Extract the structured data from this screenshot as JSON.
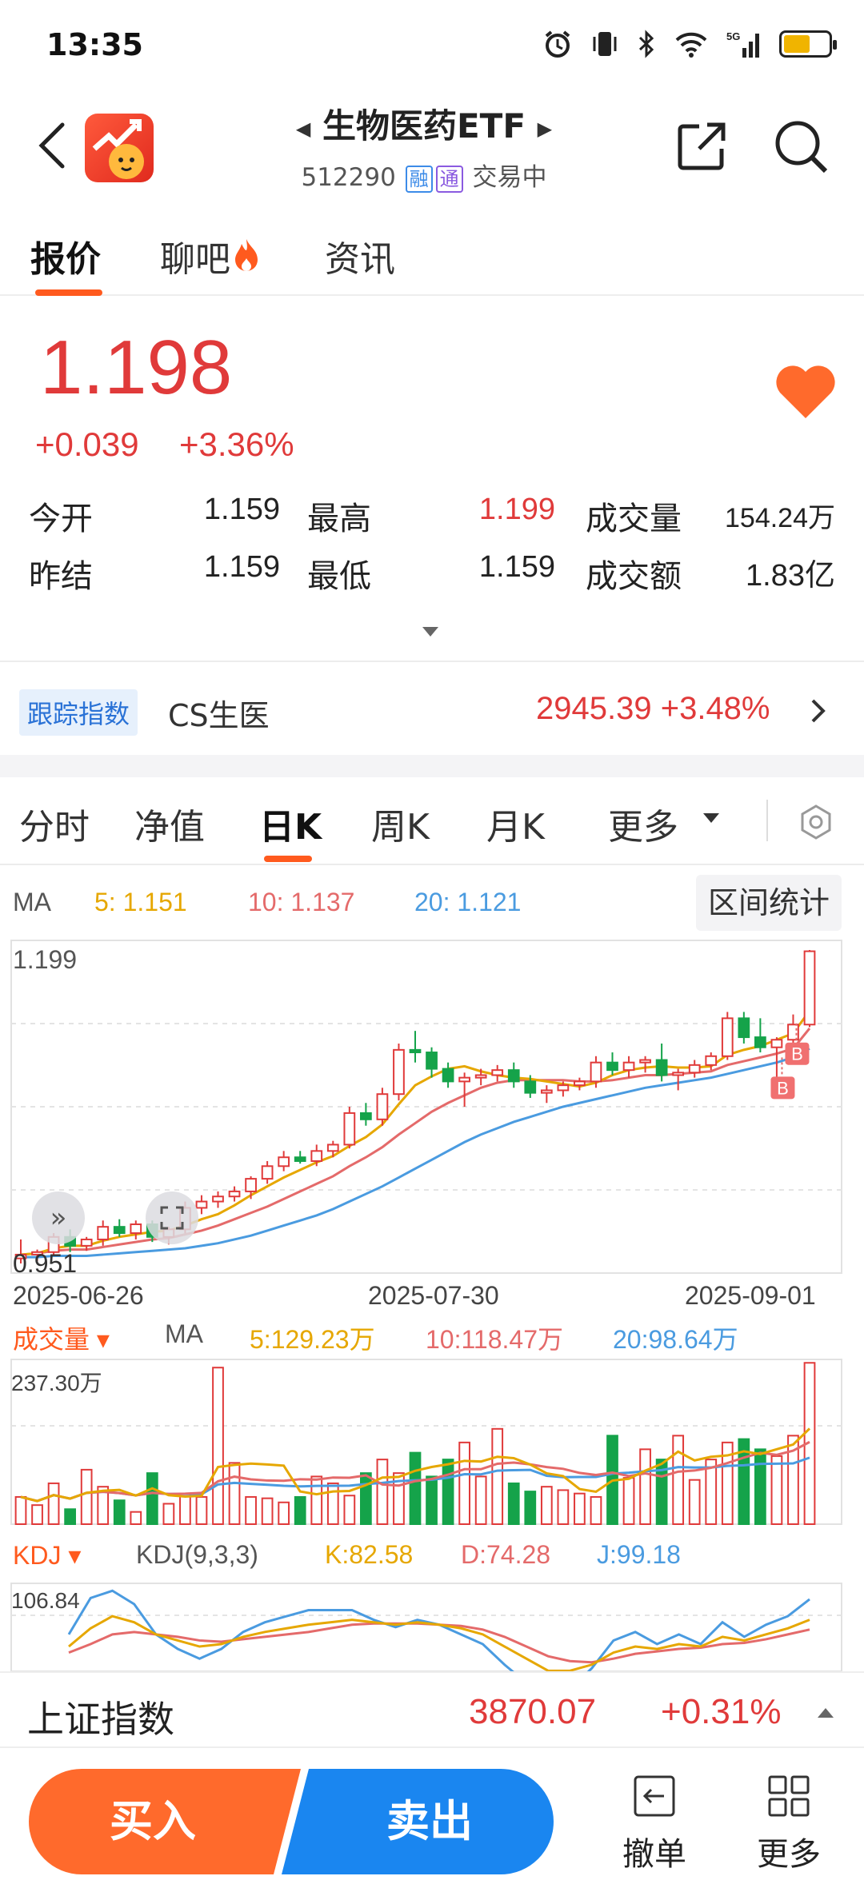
{
  "status": {
    "time": "13:35"
  },
  "header": {
    "title": "生物医药ETF",
    "code": "512290",
    "tag1": "融",
    "tag2": "通",
    "trade_status": "交易中"
  },
  "tabs": [
    {
      "label": "报价"
    },
    {
      "label": "聊吧"
    },
    {
      "label": "资讯"
    }
  ],
  "quote": {
    "price": "1.198",
    "change": "+0.039",
    "change_pct": "+3.36%",
    "open_label": "今开",
    "open": "1.159",
    "high_label": "最高",
    "high": "1.199",
    "vol_label": "成交量",
    "vol": "154.24万",
    "prev_label": "昨结",
    "prev": "1.159",
    "low_label": "最低",
    "low": "1.159",
    "amt_label": "成交额",
    "amt": "1.83亿"
  },
  "tracking": {
    "tag": "跟踪指数",
    "name": "CS生医",
    "value": "2945.39",
    "pct": "+3.48%"
  },
  "ktabs": [
    {
      "label": "分时"
    },
    {
      "label": "净值"
    },
    {
      "label": "日K"
    },
    {
      "label": "周K"
    },
    {
      "label": "月K"
    },
    {
      "label": "更多"
    }
  ],
  "ma": {
    "label": "MA",
    "ma5": "5: 1.151",
    "ma10": "10: 1.137",
    "ma20": "20: 1.121",
    "range_button": "区间统计"
  },
  "price_chart": {
    "max_label": "1.199",
    "min_label": "0.951",
    "dates": [
      "2025-06-26",
      "2025-07-30",
      "2025-09-01"
    ],
    "marker": "B"
  },
  "volume": {
    "label": "成交量",
    "ma_label": "MA",
    "ma5": "5:129.23万",
    "ma10": "10:118.47万",
    "ma20": "20:98.64万",
    "max_label": "237.30万"
  },
  "kdj": {
    "label": "KDJ",
    "params": "KDJ(9,3,3)",
    "k": "K:82.58",
    "d": "D:74.28",
    "j": "J:99.18",
    "max_label": "106.84"
  },
  "index_bar": {
    "name": "上证指数",
    "value": "3870.07",
    "pct": "+0.31%"
  },
  "actions": {
    "buy": "买入",
    "sell": "卖出",
    "cancel": "撤单",
    "more": "更多"
  },
  "colors": {
    "up": "#e03a3a",
    "down": "#15a34a",
    "accent": "#ff5a1e",
    "ma5": "#e6a700",
    "ma10": "#e46a6a",
    "ma20": "#4a9be0"
  },
  "chart_data": {
    "type": "candlestick",
    "ohlc": [
      [
        0.955,
        0.97,
        0.951,
        0.958
      ],
      [
        0.958,
        0.962,
        0.953,
        0.96
      ],
      [
        0.96,
        0.975,
        0.957,
        0.972
      ],
      [
        0.972,
        0.978,
        0.96,
        0.965
      ],
      [
        0.965,
        0.972,
        0.961,
        0.97
      ],
      [
        0.97,
        0.985,
        0.965,
        0.98
      ],
      [
        0.98,
        0.986,
        0.972,
        0.975
      ],
      [
        0.975,
        0.985,
        0.97,
        0.982
      ],
      [
        0.982,
        0.985,
        0.968,
        0.972
      ],
      [
        0.972,
        0.98,
        0.966,
        0.978
      ],
      [
        0.978,
        1.0,
        0.975,
        0.995
      ],
      [
        0.995,
        1.005,
        0.99,
        1.0
      ],
      [
        1.0,
        1.008,
        0.995,
        1.004
      ],
      [
        1.004,
        1.012,
        1.0,
        1.008
      ],
      [
        1.008,
        1.02,
        1.002,
        1.018
      ],
      [
        1.018,
        1.032,
        1.014,
        1.028
      ],
      [
        1.028,
        1.04,
        1.024,
        1.035
      ],
      [
        1.035,
        1.04,
        1.03,
        1.032
      ],
      [
        1.032,
        1.045,
        1.028,
        1.04
      ],
      [
        1.04,
        1.048,
        1.035,
        1.045
      ],
      [
        1.045,
        1.075,
        1.042,
        1.07
      ],
      [
        1.07,
        1.078,
        1.06,
        1.065
      ],
      [
        1.065,
        1.09,
        1.06,
        1.085
      ],
      [
        1.085,
        1.125,
        1.08,
        1.12
      ],
      [
        1.12,
        1.135,
        1.11,
        1.118
      ],
      [
        1.118,
        1.122,
        1.098,
        1.105
      ],
      [
        1.105,
        1.11,
        1.09,
        1.095
      ],
      [
        1.095,
        1.102,
        1.075,
        1.098
      ],
      [
        1.098,
        1.105,
        1.092,
        1.1
      ],
      [
        1.1,
        1.108,
        1.095,
        1.104
      ],
      [
        1.104,
        1.11,
        1.09,
        1.095
      ],
      [
        1.095,
        1.1,
        1.082,
        1.086
      ],
      [
        1.086,
        1.092,
        1.078,
        1.088
      ],
      [
        1.088,
        1.095,
        1.083,
        1.092
      ],
      [
        1.092,
        1.098,
        1.088,
        1.095
      ],
      [
        1.095,
        1.115,
        1.09,
        1.11
      ],
      [
        1.11,
        1.118,
        1.1,
        1.104
      ],
      [
        1.104,
        1.115,
        1.098,
        1.11
      ],
      [
        1.11,
        1.115,
        1.102,
        1.112
      ],
      [
        1.112,
        1.125,
        1.095,
        1.1
      ],
      [
        1.1,
        1.105,
        1.088,
        1.102
      ],
      [
        1.102,
        1.112,
        1.098,
        1.108
      ],
      [
        1.108,
        1.118,
        1.104,
        1.115
      ],
      [
        1.115,
        1.15,
        1.112,
        1.145
      ],
      [
        1.145,
        1.15,
        1.125,
        1.13
      ],
      [
        1.13,
        1.145,
        1.118,
        1.122
      ],
      [
        1.122,
        1.13,
        1.09,
        1.128
      ],
      [
        1.128,
        1.148,
        1.122,
        1.14
      ],
      [
        1.14,
        1.199,
        1.138,
        1.198
      ]
    ],
    "volume": [
      40,
      28,
      60,
      22,
      80,
      55,
      35,
      18,
      75,
      30,
      45,
      40,
      230,
      90,
      40,
      38,
      32,
      40,
      70,
      60,
      42,
      75,
      95,
      75,
      105,
      70,
      95,
      120,
      70,
      140,
      60,
      48,
      55,
      50,
      45,
      40,
      130,
      68,
      110,
      95,
      130,
      65,
      95,
      120,
      125,
      110,
      100,
      130,
      237
    ],
    "ma5": [
      0.958,
      0.959,
      0.963,
      0.965,
      0.965,
      0.969,
      0.972,
      0.974,
      0.976,
      0.977,
      0.981,
      0.986,
      0.99,
      0.997,
      1.005,
      1.012,
      1.019,
      1.025,
      1.031,
      1.036,
      1.044,
      1.051,
      1.061,
      1.077,
      1.092,
      1.099,
      1.105,
      1.107,
      1.103,
      1.1,
      1.098,
      1.097,
      1.095,
      1.093,
      1.091,
      1.094,
      1.1,
      1.104,
      1.106,
      1.107,
      1.106,
      1.106,
      1.107,
      1.116,
      1.12,
      1.123,
      1.128,
      1.133,
      1.151
    ],
    "ma10": [
      0.958,
      0.959,
      0.961,
      0.962,
      0.962,
      0.964,
      0.966,
      0.968,
      0.97,
      0.971,
      0.974,
      0.977,
      0.981,
      0.986,
      0.991,
      0.996,
      1.002,
      1.008,
      1.014,
      1.02,
      1.028,
      1.035,
      1.043,
      1.053,
      1.062,
      1.071,
      1.078,
      1.084,
      1.09,
      1.094,
      1.096,
      1.096,
      1.096,
      1.096,
      1.095,
      1.095,
      1.096,
      1.098,
      1.1,
      1.1,
      1.101,
      1.102,
      1.103,
      1.108,
      1.111,
      1.114,
      1.117,
      1.121,
      1.137
    ],
    "ma20": [
      0.956,
      0.956,
      0.957,
      0.957,
      0.957,
      0.958,
      0.959,
      0.96,
      0.961,
      0.962,
      0.963,
      0.965,
      0.967,
      0.97,
      0.973,
      0.977,
      0.981,
      0.985,
      0.989,
      0.994,
      1.0,
      1.006,
      1.012,
      1.019,
      1.026,
      1.033,
      1.04,
      1.047,
      1.053,
      1.058,
      1.063,
      1.067,
      1.071,
      1.075,
      1.078,
      1.081,
      1.084,
      1.087,
      1.09,
      1.092,
      1.094,
      1.096,
      1.098,
      1.101,
      1.104,
      1.107,
      1.11,
      1.114,
      1.121
    ],
    "ylim": [
      0.951,
      1.199
    ],
    "vol_ylim": [
      0,
      237.3
    ],
    "kdj_k": [
      60,
      75,
      85,
      80,
      70,
      65,
      60,
      62,
      68,
      72,
      75,
      78,
      80,
      82,
      80,
      78,
      80,
      78,
      75,
      70,
      60,
      50,
      40,
      40,
      45,
      55,
      60,
      58,
      62,
      60,
      68,
      65,
      70,
      75,
      82
    ],
    "kdj_d": [
      55,
      62,
      70,
      72,
      70,
      68,
      65,
      64,
      66,
      68,
      70,
      72,
      75,
      78,
      79,
      79,
      79,
      78,
      77,
      74,
      68,
      60,
      52,
      48,
      47,
      50,
      54,
      56,
      58,
      59,
      62,
      63,
      66,
      70,
      74
    ],
    "kdj_j": [
      70,
      100,
      106,
      95,
      70,
      58,
      50,
      58,
      72,
      80,
      85,
      90,
      90,
      90,
      82,
      76,
      82,
      78,
      70,
      62,
      45,
      30,
      15,
      25,
      42,
      65,
      72,
      62,
      70,
      62,
      80,
      68,
      78,
      85,
      99
    ],
    "kdj_ylim": [
      0,
      106.84
    ]
  }
}
